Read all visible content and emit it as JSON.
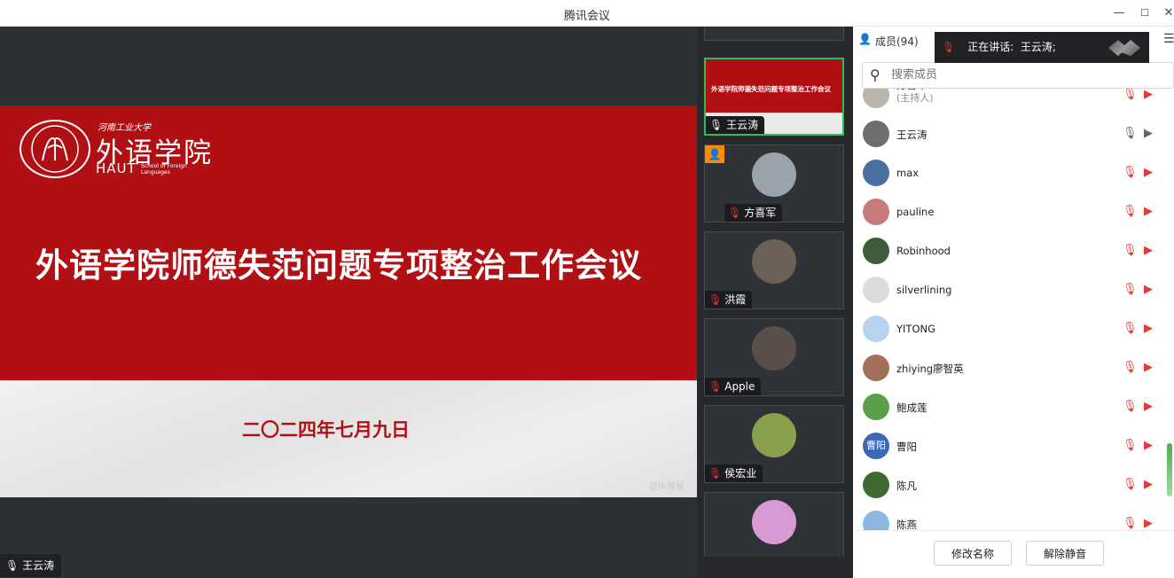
{
  "window": {
    "title": "腾讯会议",
    "min": "—",
    "max": "☐",
    "close": "✕"
  },
  "slide": {
    "logo_small": "河南工业大学",
    "logo_cn": "外语学院",
    "logo_en": "HAUT",
    "logo_en_sub": "School of Foreign Languages",
    "title": "外语学院师德失范问题专项整治工作会议",
    "date": "二〇二四年七月九日",
    "watermark": "虚拟背景"
  },
  "speaker": {
    "name": "王云涛"
  },
  "gallery": [
    {
      "name": "王云涛",
      "muted": false,
      "active": true,
      "shows_slide": true,
      "mini_title": "外语学院师德失范问题专项整治工作会议"
    },
    {
      "name": "方喜军",
      "muted": true,
      "host": true,
      "avatar_color": "#9aa3ab"
    },
    {
      "name": "洪霞",
      "muted": true,
      "avatar_color": "#6b6155"
    },
    {
      "name": "Apple",
      "muted": true,
      "avatar_color": "#5a4f48"
    },
    {
      "name": "侯宏业",
      "muted": true,
      "avatar_color": "#8aa04a"
    },
    {
      "name": "",
      "muted": true,
      "avatar_color": "#d89ad2"
    }
  ],
  "panel": {
    "members_label": "成员(94)",
    "speaking_label": "正在讲话:",
    "speaking_name": "王云涛;",
    "search_placeholder": "搜索成员",
    "members": [
      {
        "name": "方喜军",
        "role": "(主持人)",
        "mic": "off",
        "cam": "off",
        "avatar_color": "#b9b5ad"
      },
      {
        "name": "王云涛",
        "mic": "on",
        "cam": "on",
        "avatar_color": "#6d6d6d"
      },
      {
        "name": "max",
        "mic": "off",
        "cam": "off",
        "avatar_color": "#4a6fa1"
      },
      {
        "name": "pauline",
        "mic": "off",
        "cam": "off",
        "avatar_color": "#c97a7a"
      },
      {
        "name": "Robinhood",
        "mic": "off",
        "cam": "off",
        "avatar_color": "#3c5b3a"
      },
      {
        "name": "silverlining",
        "mic": "off",
        "cam": "off",
        "avatar_color": "#dcdcdc"
      },
      {
        "name": "YITONG",
        "mic": "off",
        "cam": "off",
        "avatar_color": "#b7d3f0"
      },
      {
        "name": "zhiying廖智英",
        "mic": "off",
        "cam": "off",
        "avatar_color": "#a0705a"
      },
      {
        "name": "鲍成莲",
        "mic": "off",
        "cam": "off",
        "avatar_color": "#5aa04a"
      },
      {
        "name": "曹阳",
        "avatar_text": "曹阳",
        "mic": "off",
        "cam": "off",
        "avatar_color": "#3d68b6"
      },
      {
        "name": "陈凡",
        "mic": "off",
        "cam": "off",
        "avatar_color": "#3f6a2f"
      },
      {
        "name": "陈燕",
        "mic": "off",
        "cam": "off",
        "avatar_color": "#8cb7e0"
      }
    ],
    "rename_button": "修改名称",
    "unmute_button": "解除静音"
  },
  "colors": {
    "slide_red": "#b00f14",
    "active_green": "#2bbd54",
    "muted_red": "#e53935"
  }
}
